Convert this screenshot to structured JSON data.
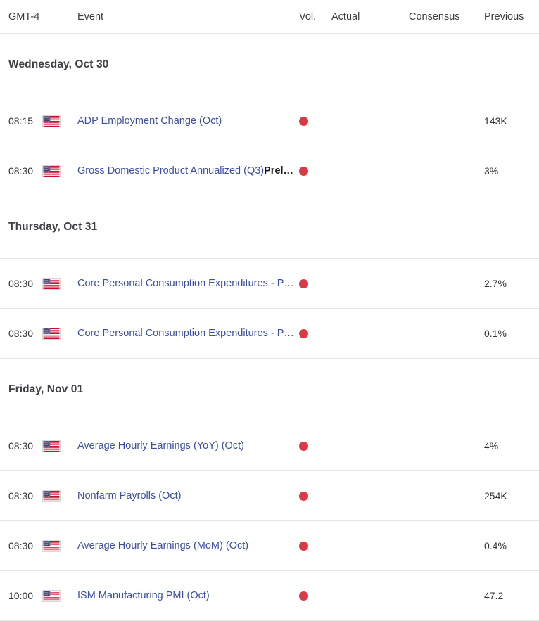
{
  "header": {
    "timezone_label": "GMT-4",
    "event_label": "Event",
    "vol_label": "Vol.",
    "actual_label": "Actual",
    "consensus_label": "Consensus",
    "previous_label": "Previous"
  },
  "colors": {
    "link": "#3b4ea0",
    "volatility_high": "#d93a45",
    "divider": "#e3e5e8",
    "text": "#333333"
  },
  "groups": [
    {
      "date": "Wednesday, Oct 30",
      "rows": [
        {
          "time": "08:15",
          "flag": "us-flag-icon",
          "event": "ADP Employment Change (Oct)",
          "event_suffix": "",
          "truncate": "none",
          "volatility": "high",
          "actual": "",
          "consensus": "",
          "previous": "143K"
        },
        {
          "time": "08:30",
          "flag": "us-flag-icon",
          "event": "Gross Domestic Product Annualized (Q3)",
          "event_suffix": "Prel…",
          "truncate": "gdp",
          "volatility": "high",
          "actual": "",
          "consensus": "",
          "previous": "3%"
        }
      ]
    },
    {
      "date": "Thursday, Oct 31",
      "rows": [
        {
          "time": "08:30",
          "flag": "us-flag-icon",
          "event": "Core Personal Consumption Expenditures - Price Index (YoY) (Sep)",
          "event_suffix": "",
          "truncate": "short",
          "volatility": "high",
          "actual": "",
          "consensus": "",
          "previous": "2.7%"
        },
        {
          "time": "08:30",
          "flag": "us-flag-icon",
          "event": "Core Personal Consumption Expenditures - Price Index (MoM) (Sep)",
          "event_suffix": "",
          "truncate": "short",
          "volatility": "high",
          "actual": "",
          "consensus": "",
          "previous": "0.1%"
        }
      ]
    },
    {
      "date": "Friday, Nov 01",
      "rows": [
        {
          "time": "08:30",
          "flag": "us-flag-icon",
          "event": "Average Hourly Earnings (YoY) (Oct)",
          "event_suffix": "",
          "truncate": "none",
          "volatility": "high",
          "actual": "",
          "consensus": "",
          "previous": "4%"
        },
        {
          "time": "08:30",
          "flag": "us-flag-icon",
          "event": "Nonfarm Payrolls (Oct)",
          "event_suffix": "",
          "truncate": "none",
          "volatility": "high",
          "actual": "",
          "consensus": "",
          "previous": "254K"
        },
        {
          "time": "08:30",
          "flag": "us-flag-icon",
          "event": "Average Hourly Earnings (MoM) (Oct)",
          "event_suffix": "",
          "truncate": "none",
          "volatility": "high",
          "actual": "",
          "consensus": "",
          "previous": "0.4%"
        },
        {
          "time": "10:00",
          "flag": "us-flag-icon",
          "event": "ISM Manufacturing PMI (Oct)",
          "event_suffix": "",
          "truncate": "none",
          "volatility": "high",
          "actual": "",
          "consensus": "",
          "previous": "47.2"
        }
      ]
    }
  ]
}
